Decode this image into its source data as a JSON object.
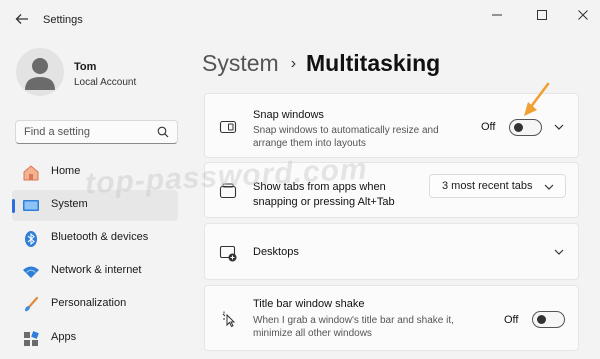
{
  "window": {
    "title": "Settings",
    "controls": [
      "minimize",
      "maximize",
      "close"
    ]
  },
  "profile": {
    "name": "Tom",
    "account_type": "Local Account"
  },
  "search": {
    "placeholder": "Find a setting"
  },
  "sidebar": {
    "items": [
      {
        "label": "Home",
        "icon": "home-icon"
      },
      {
        "label": "System",
        "icon": "system-icon",
        "active": true
      },
      {
        "label": "Bluetooth & devices",
        "icon": "bluetooth-icon"
      },
      {
        "label": "Network & internet",
        "icon": "wifi-icon"
      },
      {
        "label": "Personalization",
        "icon": "brush-icon"
      },
      {
        "label": "Apps",
        "icon": "apps-icon"
      }
    ]
  },
  "breadcrumb": {
    "parent": "System",
    "separator": "›",
    "current": "Multitasking"
  },
  "settings": {
    "snap": {
      "title": "Snap windows",
      "description": "Snap windows to automatically resize and arrange them into layouts",
      "toggle_label": "Off"
    },
    "tabs": {
      "title": "Show tabs from apps when snapping or pressing Alt+Tab",
      "dropdown_value": "3 most recent tabs"
    },
    "desktops": {
      "title": "Desktops"
    },
    "shake": {
      "title": "Title bar window shake",
      "description": "When I grab a window's title bar and shake it, minimize all other windows",
      "toggle_label": "Off"
    }
  },
  "watermark": "top-password.com",
  "colors": {
    "accent": "#2e6ae0",
    "annotation_arrow": "#f0a030"
  }
}
